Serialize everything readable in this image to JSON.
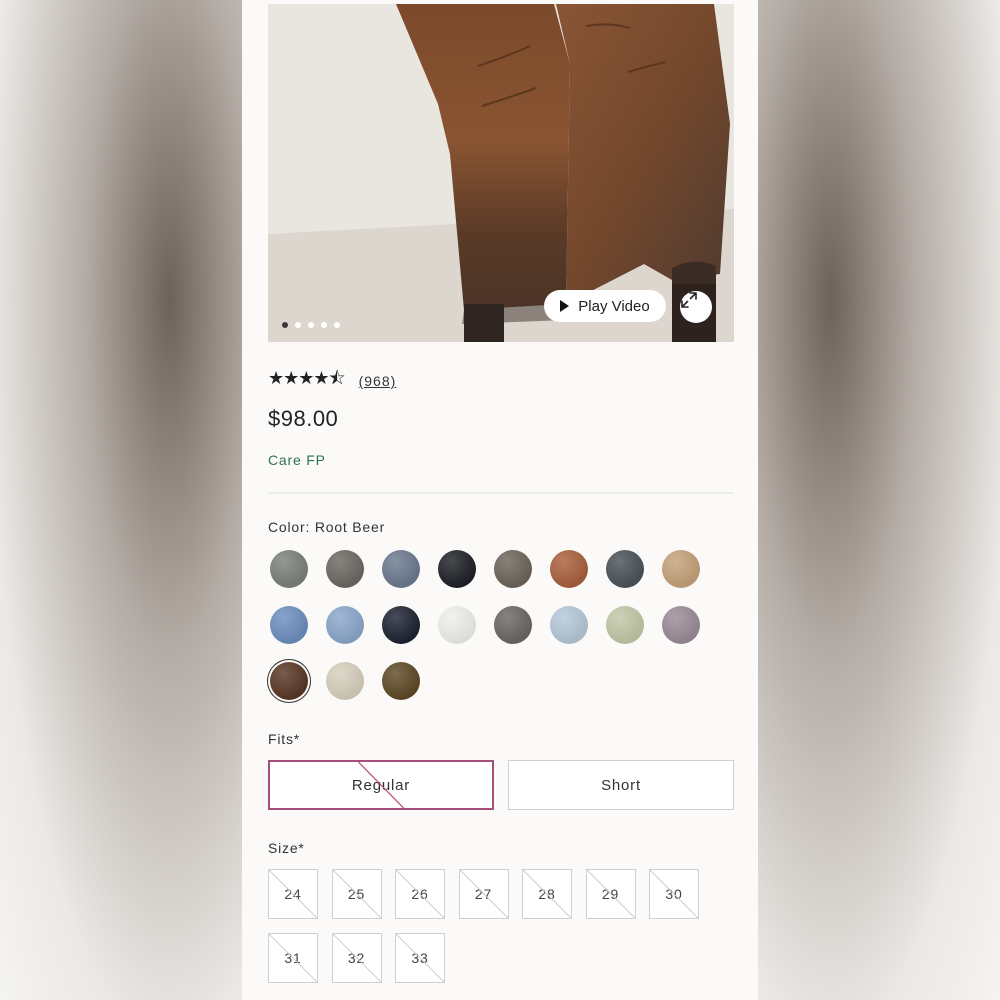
{
  "hero": {
    "play_label": "Play Video",
    "dots": 5,
    "active_dot": 0
  },
  "rating": {
    "stars": "★★★★⯪",
    "value": 4.5,
    "count": "(968)"
  },
  "price": "$98.00",
  "care_link": "Care FP",
  "color": {
    "label": "Color: Root Beer",
    "swatches": [
      "#7b817a",
      "#6d6863",
      "#6c7a8f",
      "#1f2127",
      "#6e655b",
      "#a9603d",
      "#4b5359",
      "#c5a27a",
      "#6c8fbf",
      "#8ba7cc",
      "#1f2433",
      "#efefec",
      "#6a6866",
      "#b5c8d8",
      "#c2c8a8",
      "#9a8c97",
      "#5a3726",
      "#d6d0bd",
      "#5f4a26"
    ],
    "selected_index": 16
  },
  "fits": {
    "label": "Fits*",
    "options": [
      "Regular",
      "Short"
    ]
  },
  "size": {
    "label": "Size*",
    "options": [
      "24",
      "25",
      "26",
      "27",
      "28",
      "29",
      "30",
      "31",
      "32",
      "33"
    ]
  }
}
